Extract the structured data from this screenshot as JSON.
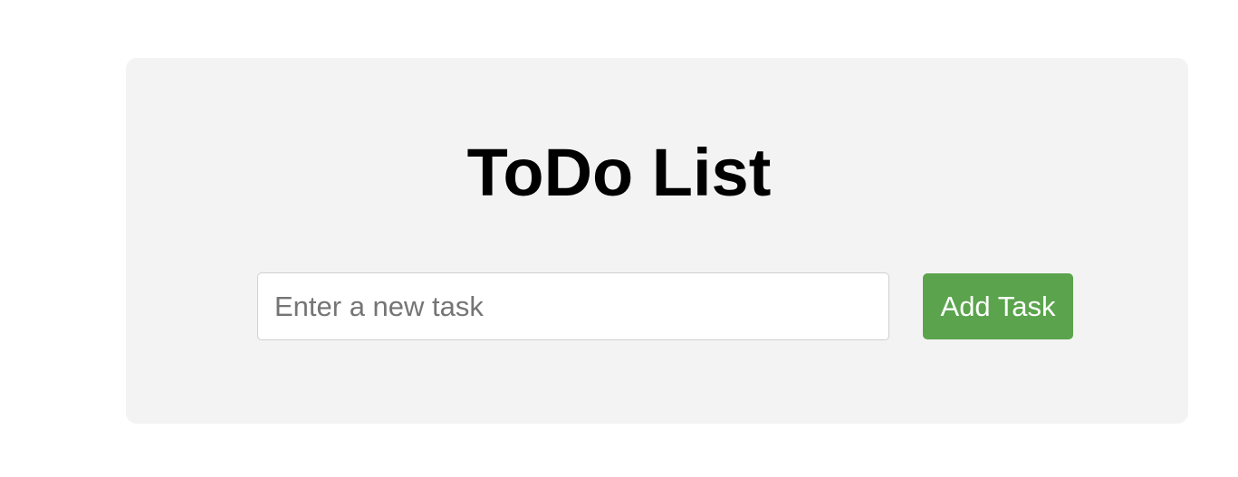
{
  "app": {
    "title": "ToDo List"
  },
  "task_form": {
    "input_value": "",
    "input_placeholder": "Enter a new task",
    "add_button_label": "Add Task"
  },
  "colors": {
    "page_background": "#ffffff",
    "card_background": "#f3f3f3",
    "add_button_background": "#5ba44d",
    "add_button_text": "#ffffff",
    "title_text": "#000000"
  }
}
